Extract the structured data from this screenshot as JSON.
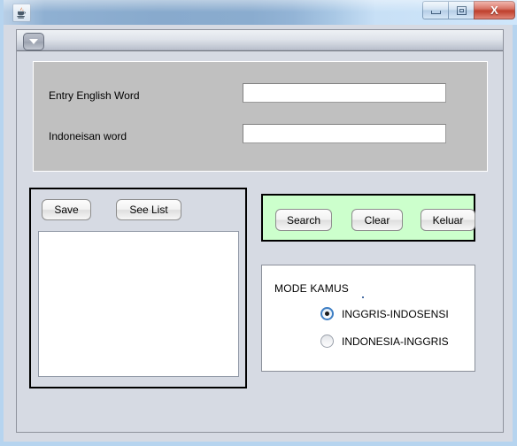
{
  "window": {
    "icon_name": "java-coffee-cup-icon",
    "title": "",
    "controls": {
      "minimize_label": "",
      "maximize_label": "",
      "close_label": "X"
    }
  },
  "toolbar": {
    "dropdown_arrow_label": ""
  },
  "form": {
    "english_label": "Entry English Word",
    "english_value": "",
    "english_placeholder": "",
    "indonesian_label": "Indoneisan word",
    "indonesian_value": "",
    "indonesian_placeholder": ""
  },
  "left_panel": {
    "save_label": "Save",
    "see_list_label": "See List",
    "list_content": ""
  },
  "actions": {
    "search_label": "Search",
    "clear_label": "Clear",
    "keluar_label": "Keluar",
    "panel_color": "#CCFFCC"
  },
  "mode": {
    "title": "MODE KAMUS",
    "options": [
      {
        "label": "INGGRIS-INDOSENSI",
        "selected": true
      },
      {
        "label": "INDONESIA-INGGRIS",
        "selected": false
      }
    ]
  },
  "colors": {
    "form_panel_bg": "#C0C0C0",
    "content_bg": "#D6DAE3",
    "green_panel": "#CCFFCC",
    "close_button": "#BC3A26",
    "radio_selected_ring": "#3F7FC4"
  }
}
